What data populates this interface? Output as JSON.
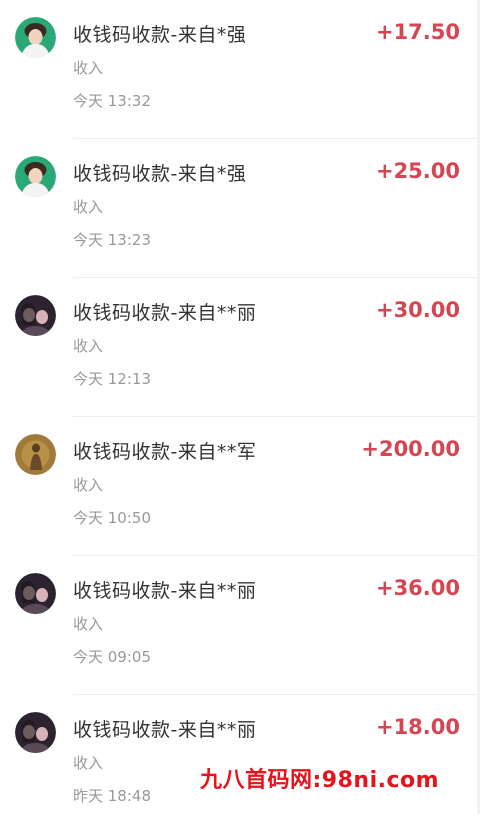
{
  "transactions": [
    {
      "title": "收钱码收款-来自*强",
      "type": "收入",
      "time": "今天 13:32",
      "amount": "+17.50",
      "avatar": "avatar-green-bg"
    },
    {
      "title": "收钱码收款-来自*强",
      "type": "收入",
      "time": "今天 13:23",
      "amount": "+25.00",
      "avatar": "avatar-green-bg"
    },
    {
      "title": "收钱码收款-来自**丽",
      "type": "收入",
      "time": "今天 12:13",
      "amount": "+30.00",
      "avatar": "avatar-dark-couple"
    },
    {
      "title": "收钱码收款-来自**军",
      "type": "收入",
      "time": "今天 10:50",
      "amount": "+200.00",
      "avatar": "avatar-brown"
    },
    {
      "title": "收钱码收款-来自**丽",
      "type": "收入",
      "time": "今天 09:05",
      "amount": "+36.00",
      "avatar": "avatar-dark-couple"
    },
    {
      "title": "收钱码收款-来自**丽",
      "type": "收入",
      "time": "昨天 18:48",
      "amount": "+18.00",
      "avatar": "avatar-dark-couple"
    }
  ],
  "watermark": "九八首码网:98ni.com",
  "colors": {
    "amount": "#d64552",
    "title": "#333333",
    "secondary": "#999999",
    "watermark": "#e8121b"
  }
}
